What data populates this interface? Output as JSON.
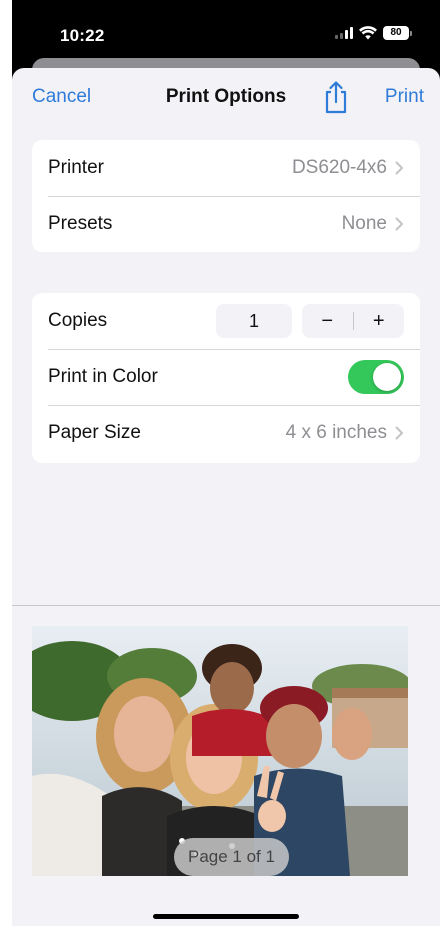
{
  "status_bar": {
    "time": "10:22",
    "battery": "80"
  },
  "nav": {
    "cancel_label": "Cancel",
    "title": "Print Options",
    "share_icon": "share-icon",
    "print_label": "Print"
  },
  "printer_group": {
    "printer_label": "Printer",
    "printer_value": "DS620-4x6",
    "presets_label": "Presets",
    "presets_value": "None"
  },
  "options_group": {
    "copies_label": "Copies",
    "copies_value": "1",
    "decrement_symbol": "−",
    "increment_symbol": "+",
    "color_label": "Print in Color",
    "color_enabled": true,
    "paper_size_label": "Paper Size",
    "paper_size_value": "4 x 6 inches"
  },
  "preview": {
    "page_indicator": "Page 1 of 1"
  },
  "colors": {
    "accent": "#2f7bd8",
    "toggle_on": "#34c759",
    "background": "#f2f2f7"
  }
}
